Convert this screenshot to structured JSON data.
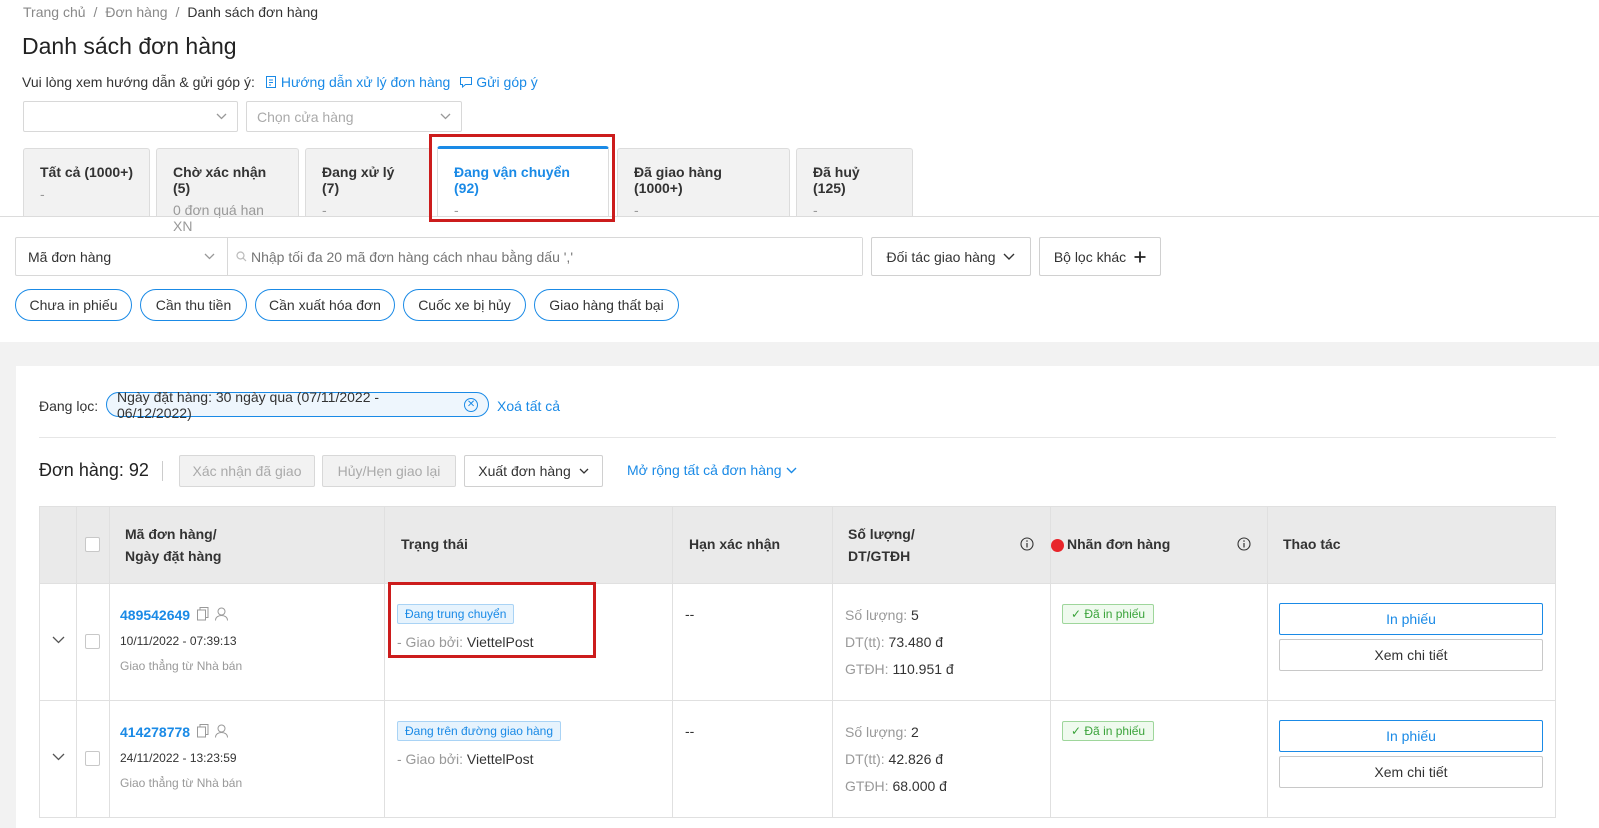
{
  "breadcrumb": [
    "Trang chủ",
    "Đơn hàng",
    "Danh sách đơn hàng"
  ],
  "breadcrumb_sep": "/",
  "page_title": "Danh sách đơn hàng",
  "guide": {
    "text": "Vui lòng xem hướng dẫn & gửi góp ý:",
    "link1": "Hướng dẫn xử lý đơn hàng",
    "link2": "Gửi góp ý"
  },
  "selects": {
    "first_value": "",
    "store_placeholder": "Chọn cửa hàng"
  },
  "tabs": [
    {
      "title": "Tất cả (1000+)",
      "sub": "-"
    },
    {
      "title": "Chờ xác nhận (5)",
      "sub": "0 đơn quá hạn XN"
    },
    {
      "title": "Đang xử lý (7)",
      "sub": "-"
    },
    {
      "title": "Đang vận chuyển (92)",
      "sub": "-",
      "active": true
    },
    {
      "title": "Đã giao hàng (1000+)",
      "sub": "-"
    },
    {
      "title": "Đã huỷ (125)",
      "sub": "-"
    }
  ],
  "search": {
    "type": "Mã đơn hàng",
    "placeholder": "Nhập tối đa 20 mã đơn hàng cách nhau bằng dấu ','",
    "partner": "Đối tác giao hàng",
    "more_filters": "Bộ lọc khác"
  },
  "quick_filters": [
    "Chưa in phiếu",
    "Cần thu tiền",
    "Cần xuất hóa đơn",
    "Cuốc xe bị hủy",
    "Giao hàng thất bại"
  ],
  "active_filter": {
    "label": "Đang lọc:",
    "chip": "Ngày đặt hàng: 30 ngày qua (07/11/2022 - 06/12/2022)",
    "clear": "Xoá tất cả"
  },
  "toolbar": {
    "count": "Đơn hàng: 92",
    "confirm_delivered": "Xác nhận đã giao",
    "cancel_reschedule": "Hủy/Hẹn giao lại",
    "export": "Xuất đơn hàng",
    "expand_all": "Mở rộng tất cả đơn hàng"
  },
  "columns": {
    "order_line1": "Mã đơn hàng/",
    "order_line2": "Ngày đặt hàng",
    "status": "Trạng thái",
    "deadline": "Hạn xác nhận",
    "qty_line1": "Số lượng/",
    "qty_line2": "DT/GTĐH",
    "label": "Nhãn đơn hàng",
    "actions": "Thao tác"
  },
  "rows": [
    {
      "id": "489542649",
      "date": "10/11/2022 - 07:39:13",
      "ship_note": "Giao thẳng từ Nhà bán",
      "status": "Đang trung chuyển",
      "carrier_label": "- Giao bởi: ",
      "carrier": "ViettelPost",
      "deadline": "--",
      "qty_label": "Số lượng: ",
      "qty": "5",
      "dt_label": "DT(tt): ",
      "dt": "73.480 đ",
      "gtdh_label": "GTĐH: ",
      "gtdh": "110.951 đ",
      "tag": "✓ Đã in phiếu",
      "print": "In phiếu",
      "detail": "Xem chi tiết"
    },
    {
      "id": "414278778",
      "date": "24/11/2022 - 13:23:59",
      "ship_note": "Giao thẳng từ Nhà bán",
      "status": "Đang trên đường giao hàng",
      "carrier_label": "- Giao bởi: ",
      "carrier": "ViettelPost",
      "deadline": "--",
      "qty_label": "Số lượng: ",
      "qty": "2",
      "dt_label": "DT(tt): ",
      "dt": "42.826 đ",
      "gtdh_label": "GTĐH: ",
      "gtdh": "68.000 đ",
      "tag": "✓ Đã in phiếu",
      "print": "In phiếu",
      "detail": "Xem chi tiết"
    }
  ],
  "colors": {
    "accent": "#1a8ae6",
    "highlight": "#cc1c1c",
    "label_dot": "#e8252b"
  }
}
